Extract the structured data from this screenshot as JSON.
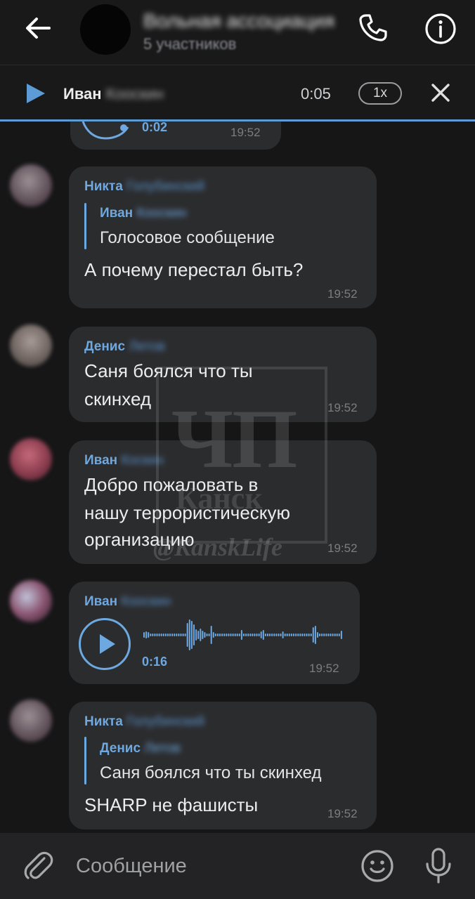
{
  "header": {
    "title": "Вольная ассоциация",
    "subtitle": "5 участников",
    "colors": {
      "background": "#19191a",
      "accent": "#6ea8e1"
    }
  },
  "player": {
    "name": "Иван",
    "name_hidden": "Кооскин",
    "time": "0:05",
    "speed": "1x"
  },
  "messages": [
    {
      "type": "voice-partial",
      "duration": "0:02",
      "time": "19:52"
    },
    {
      "type": "reply",
      "sender": "Никта",
      "sender_hidden": "Голубинский",
      "quote_name": "Иван",
      "quote_name_hidden": "Кооскин",
      "quote_text": "Голосовое сообщение",
      "text": "А почему перестал быть?",
      "time": "19:52"
    },
    {
      "type": "text",
      "sender": "Денис",
      "sender_hidden": "Летов",
      "lines": [
        "Саня боялся что ты",
        "скинхед"
      ],
      "time": "19:52"
    },
    {
      "type": "text",
      "sender": "Иван",
      "sender_hidden": "Коскин",
      "lines": [
        "Добро пожаловать в",
        "нашу террористическую",
        "организацию"
      ],
      "time": "19:52"
    },
    {
      "type": "voice",
      "sender": "Иван",
      "sender_hidden": "Кооскин",
      "duration": "0:16",
      "time": "19:52"
    },
    {
      "type": "reply",
      "sender": "Никта",
      "sender_hidden": "Голубинский",
      "quote_name": "Денис",
      "quote_name_hidden": "Летов",
      "quote_text": "Саня боялся что ты скинхед",
      "text": "SHARP не фашисты",
      "time": "19:52"
    }
  ],
  "watermark": {
    "big": "ЧП",
    "city": "Канск",
    "handle": "@KanskLife"
  },
  "composer": {
    "placeholder": "Сообщение"
  },
  "icons": {
    "back": "arrow-left-icon",
    "call": "phone-icon",
    "info": "info-icon",
    "play": "play-icon",
    "close": "close-icon",
    "attach": "paperclip-icon",
    "emoji": "smile-icon",
    "mic": "microphone-icon"
  }
}
